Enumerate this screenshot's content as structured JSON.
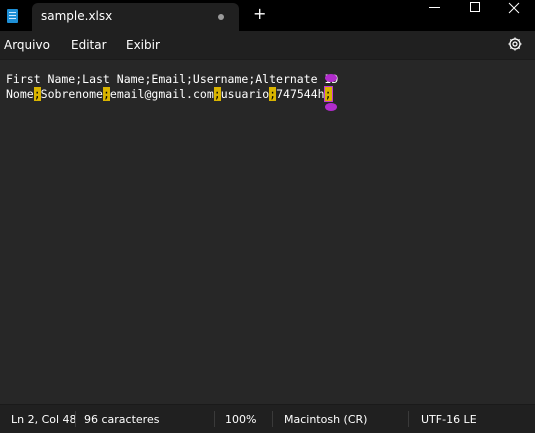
{
  "tab": {
    "title": "sample.xlsx",
    "new_tab": "+"
  },
  "menu": {
    "items": [
      "Arquivo",
      "Editar",
      "Exibir"
    ]
  },
  "editor": {
    "line1": "First Name;Last Name;Email;Username;Alternate ID",
    "line2_parts": [
      "Nome",
      ";",
      "Sobrenome",
      ";",
      "email@gmail.com",
      ";",
      "usuario",
      ";",
      "747544h",
      ";"
    ]
  },
  "status": {
    "position": "Ln 2, Col 48",
    "chars": "96 caracteres",
    "zoom": "100%",
    "line_ending": "Macintosh (CR)",
    "encoding": "UTF-16 LE"
  },
  "colors": {
    "highlight": "#d9b400",
    "marker": "#b12ccc",
    "accent_icon": "#1e8fd6"
  }
}
